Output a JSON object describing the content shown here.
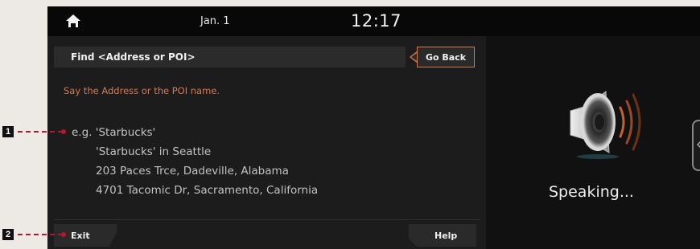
{
  "status_bar": {
    "home_icon": "home-icon",
    "date": "Jan. 1",
    "time": "12:17"
  },
  "header": {
    "title": "Find <Address or POI>",
    "go_back_label": "Go Back"
  },
  "prompt": "Say the Address or the POI name.",
  "examples": [
    "e.g. 'Starbucks'",
    "'Starbucks' in Seattle",
    "203 Paces Trce, Dadeville, Alabama",
    "4701 Tacomic Dr, Sacramento, California"
  ],
  "footer": {
    "exit_label": "Exit",
    "help_label": "Help"
  },
  "voice_panel": {
    "icon": "speaker-icon",
    "status": "Speaking..."
  },
  "callouts": [
    "1",
    "2"
  ],
  "colors": {
    "accent": "#d9794e",
    "callout_line": "#b4182a",
    "background": "#151515"
  }
}
